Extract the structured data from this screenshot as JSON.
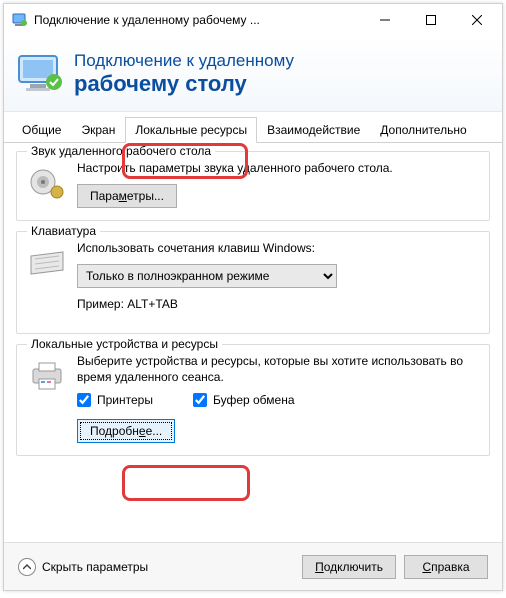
{
  "titlebar": {
    "text": "Подключение к удаленному рабочему ..."
  },
  "header": {
    "line1": "Подключение к удаленному",
    "line2": "рабочему столу"
  },
  "tabs": {
    "items": [
      {
        "label": "Общие"
      },
      {
        "label": "Экран"
      },
      {
        "label": "Локальные ресурсы"
      },
      {
        "label": "Взаимодействие"
      },
      {
        "label": "Дополнительно"
      }
    ]
  },
  "sound": {
    "title": "Звук удаленного рабочего стола",
    "desc": "Настроить параметры звука удаленного рабочего стола.",
    "btn_pre": "Пара",
    "btn_ul": "м",
    "btn_post": "етры..."
  },
  "keyboard": {
    "title": "Клавиатура",
    "desc": "Использовать сочетания клавиш Windows:",
    "selected": "Только в полноэкранном режиме",
    "example": "Пример: ALT+TAB"
  },
  "local": {
    "title": "Локальные устройства и ресурсы",
    "desc": "Выберите устройства и ресурсы, которые вы хотите использовать во время удаленного сеанса.",
    "printers": "Принтеры",
    "clipboard": "Буфер обмена",
    "more_pre": "Подробн",
    "more_ul": "е",
    "more_post": "е..."
  },
  "footer": {
    "hide": "Скрыть параметры",
    "hide_ul": "п",
    "connect": "Подключить",
    "connect_ul": "П",
    "help": "Справка",
    "help_ul": "С"
  }
}
